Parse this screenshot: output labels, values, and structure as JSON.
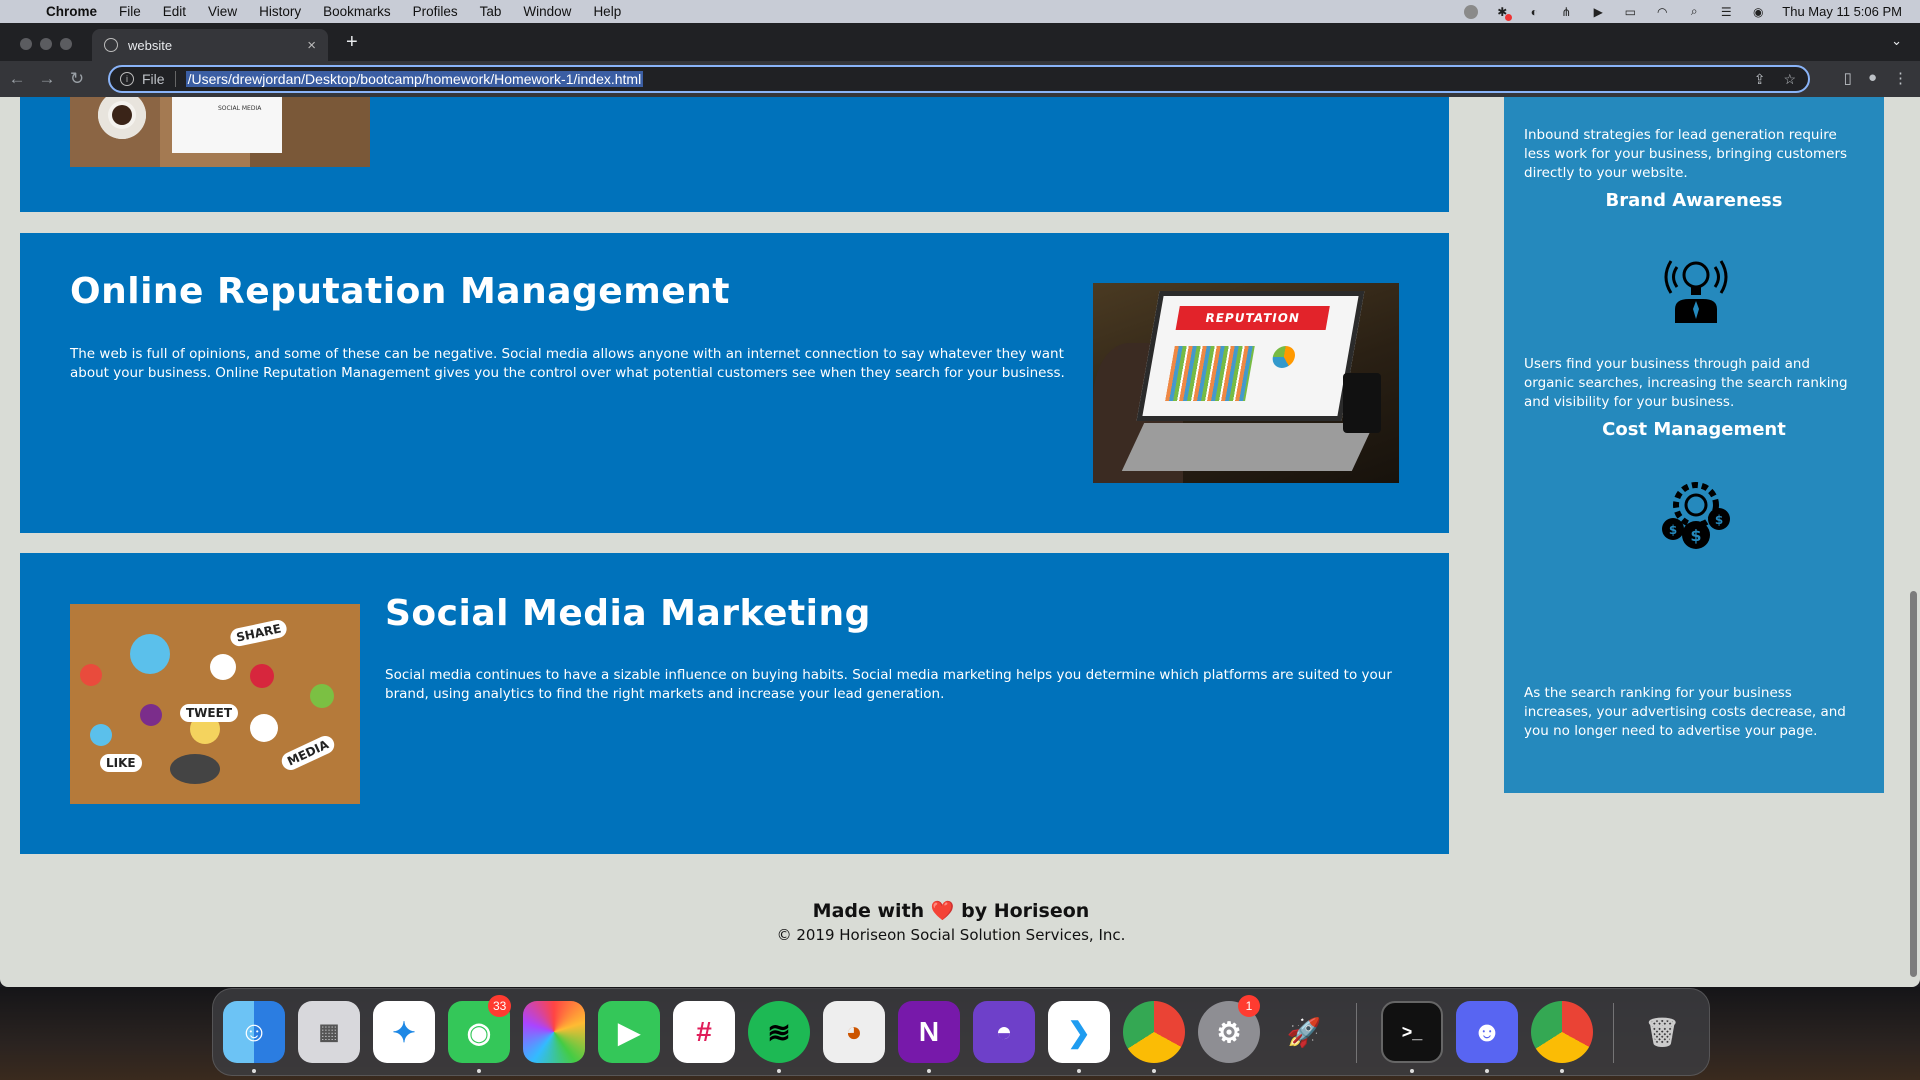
{
  "menubar": {
    "app": "Chrome",
    "items": [
      "File",
      "Edit",
      "View",
      "History",
      "Bookmarks",
      "Profiles",
      "Tab",
      "Window",
      "Help"
    ],
    "clock": "Thu May 11  5:06 PM"
  },
  "browser": {
    "tab_title": "website",
    "scheme_label": "File",
    "url": "/Users/drewjordan/Desktop/bootcamp/homework/Homework-1/index.html"
  },
  "page": {
    "image1_text": "SOCIAL MEDIA",
    "reputation": {
      "heading": "Online Reputation Management",
      "body": "The web is full of opinions, and some of these can be negative. Social media allows anyone with an internet connection to say whatever they want about your business. Online Reputation Management gives you the control over what potential customers see when they search for your business.",
      "image_banner": "REPUTATION"
    },
    "social": {
      "heading": "Social Media Marketing",
      "body": "Social media continues to have a sizable influence on buying habits. Social media marketing helps you determine which platforms are suited to your brand, using analytics to find the right markets and increase your lead generation.",
      "image_words": [
        "SHARE",
        "TWEET",
        "LIKE",
        "MEDIA"
      ]
    },
    "sidebar": {
      "lead_text": "Inbound strategies for lead generation require less work for your business, bringing customers directly to your website.",
      "brand_title": "Brand Awareness",
      "brand_text": "Users find your business through paid and organic searches, increasing the search ranking and visibility for your business.",
      "cost_title": "Cost Management",
      "cost_text": "As the search ranking for your business increases, your advertising costs decrease, and you no longer need to advertise your page."
    },
    "footer": {
      "made_with": "Made with",
      "heart": "❤️",
      "by": "by Horiseon",
      "copyright": "© 2019 Horiseon Social Solution Services, Inc."
    }
  },
  "dock": {
    "messages_badge": "33",
    "settings_badge": "1",
    "terminal_glyph": ">_",
    "onenote_glyph": "N"
  },
  "colors": {
    "card_blue": "#0072bb",
    "sidebar_blue": "#2589bd",
    "page_bg": "#d9dcd6"
  }
}
